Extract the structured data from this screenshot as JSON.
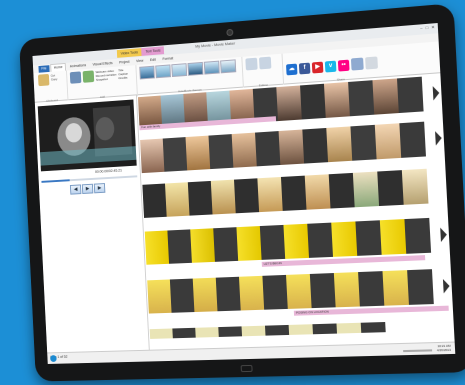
{
  "window": {
    "title": "My Movie - Movie Maker",
    "context_tabs": [
      "Video Tools",
      "Text Tools"
    ],
    "controls": [
      "–",
      "□",
      "✕"
    ]
  },
  "tabs": [
    "File",
    "Home",
    "Animations",
    "Visual Effects",
    "Project",
    "View",
    "Edit",
    "Format"
  ],
  "ribbon": {
    "groups": [
      {
        "label": "Clipboard",
        "items": [
          "Paste",
          "Cut",
          "Copy"
        ]
      },
      {
        "label": "Add",
        "items": [
          "Add videos and photos",
          "Add music",
          "Webcam video",
          "Record narration",
          "Snapshot",
          "Title",
          "Caption",
          "Credits"
        ]
      },
      {
        "label": "AutoMovie themes",
        "items": []
      },
      {
        "label": "Editing",
        "items": [
          "Rotate left",
          "Rotate right"
        ]
      },
      {
        "label": "Share",
        "items": [
          "Select",
          "Save movie",
          "Sign in"
        ]
      }
    ],
    "share_services": [
      {
        "name": "skydrive-icon",
        "glyph": "☁",
        "color": "#1e6fd0"
      },
      {
        "name": "facebook-icon",
        "glyph": "f",
        "color": "#3b5998"
      },
      {
        "name": "youtube-icon",
        "glyph": "▶",
        "color": "#d9252a"
      },
      {
        "name": "vimeo-icon",
        "glyph": "v",
        "color": "#1ab7ea"
      },
      {
        "name": "flickr-icon",
        "glyph": "••",
        "color": "#ff0084"
      }
    ]
  },
  "preview": {
    "timecode": "00:00.00/02:45.21"
  },
  "storyboard": {
    "captions": [
      "Fun with family",
      "LET'S BEGIN",
      "POSING ON LOCATION"
    ]
  },
  "status": {
    "item": "Item 1 of 52"
  },
  "taskbar": {
    "time": "10:21 AM",
    "date": "4/26/2013"
  }
}
